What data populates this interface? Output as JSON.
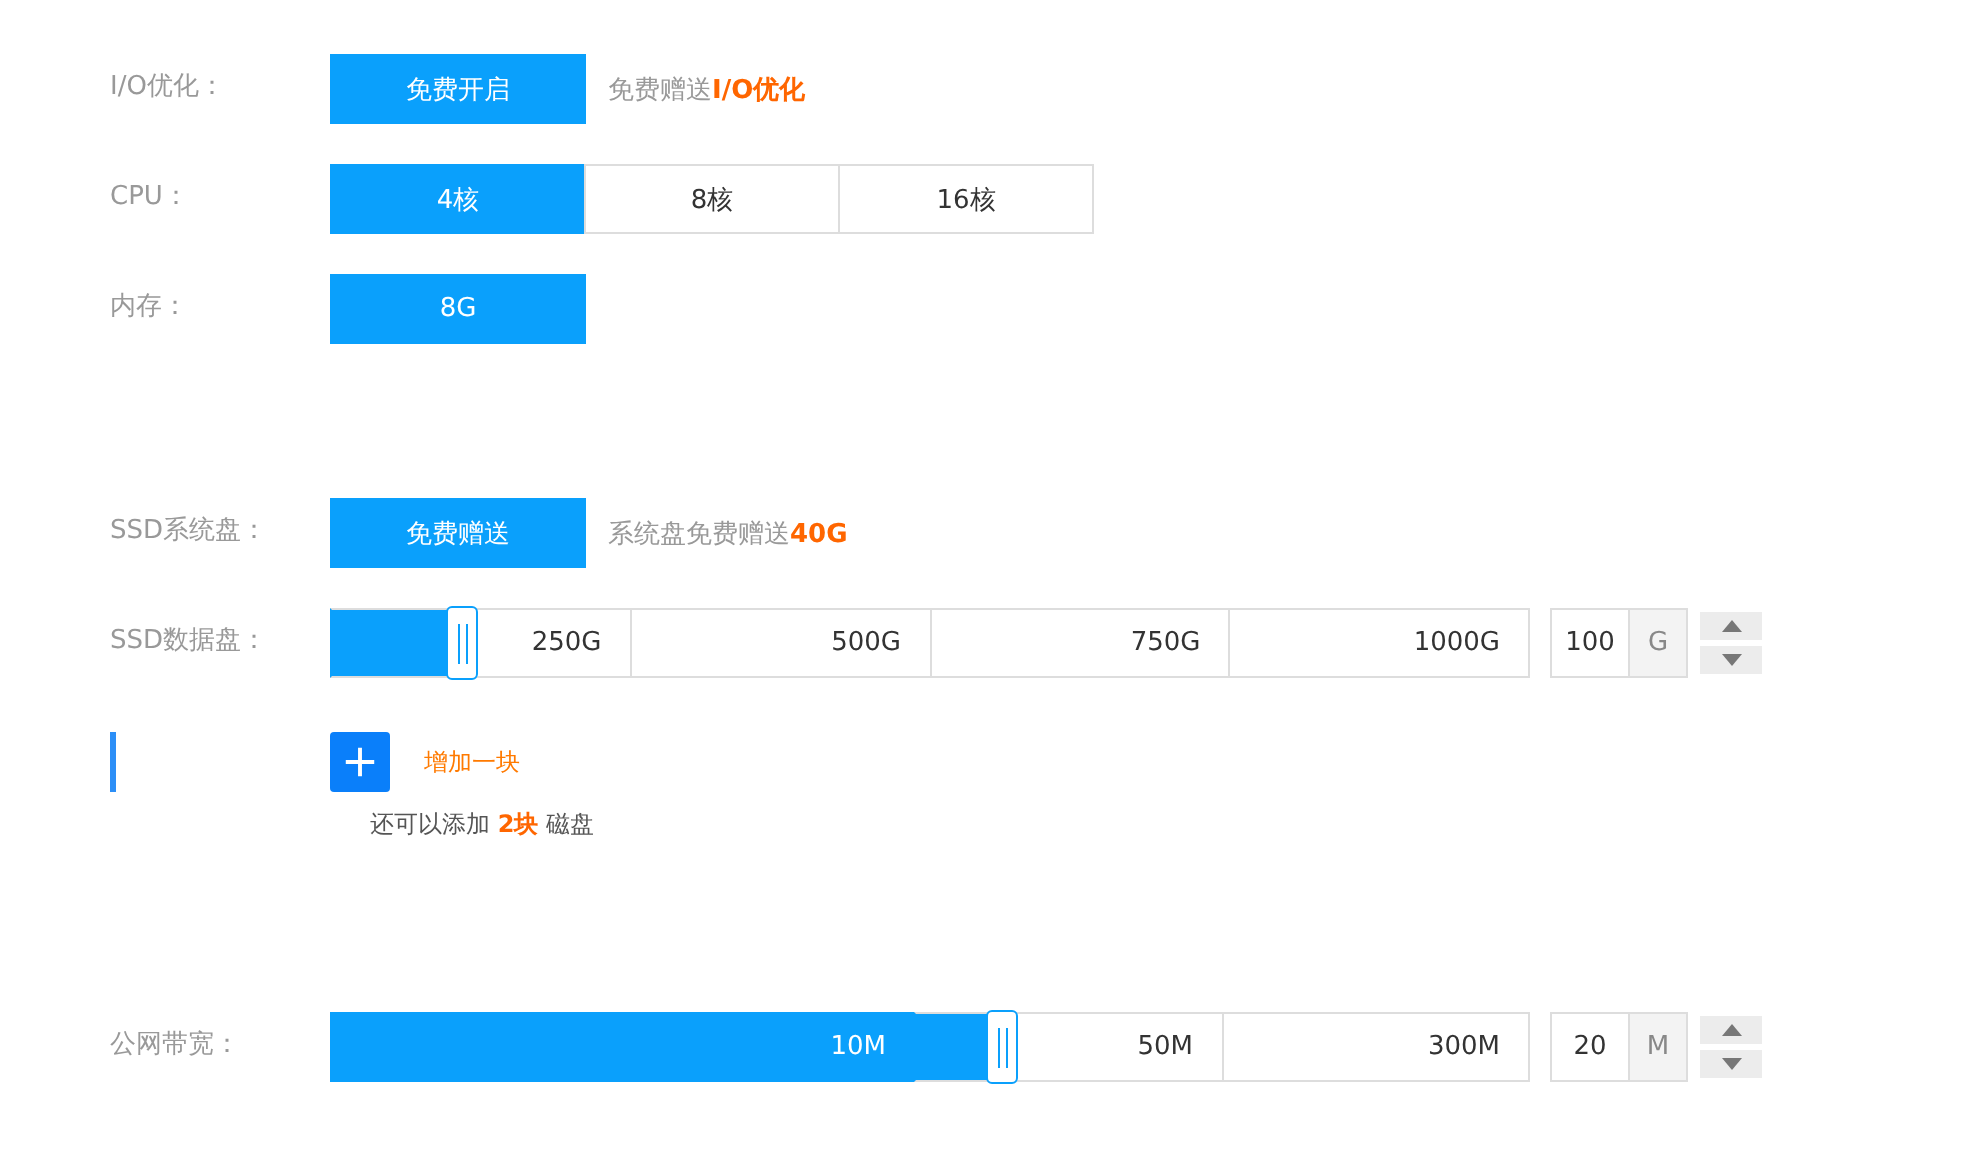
{
  "sections": [
    {
      "rows": [
        {
          "kind": "options",
          "label": "I/O优化：",
          "options": [
            {
              "label": "免费开启",
              "selected": true
            }
          ],
          "note": "免费赠送**I/O优化**"
        },
        {
          "kind": "options",
          "label": "CPU：",
          "options": [
            {
              "label": "4核",
              "selected": true
            },
            {
              "label": "8核",
              "selected": false
            },
            {
              "label": "16核",
              "selected": false
            }
          ]
        },
        {
          "kind": "options",
          "label": "内存：",
          "options": [
            {
              "label": "8G",
              "selected": true
            }
          ]
        }
      ]
    },
    {
      "rows": [
        {
          "kind": "options",
          "label": "SSD系统盘：",
          "options": [
            {
              "label": "免费赠送",
              "selected": true
            }
          ],
          "note": "系统盘免费赠送**40G**"
        },
        {
          "kind": "slider",
          "label": "SSD数据盘：",
          "stops": [
            "250G",
            "500G",
            "750G",
            "1000G"
          ],
          "level": 0.11,
          "value": "100",
          "unit": "G"
        },
        {
          "kind": "add",
          "action": "增加一块",
          "note": "还可以添加 **2块** 磁盘"
        }
      ]
    },
    {
      "rows": [
        {
          "kind": "slider",
          "label": "公网带宽：",
          "stops": [
            "10M",
            "50M",
            "300M"
          ],
          "level": 0.56,
          "value": "20",
          "unit": "M"
        }
      ]
    }
  ]
}
